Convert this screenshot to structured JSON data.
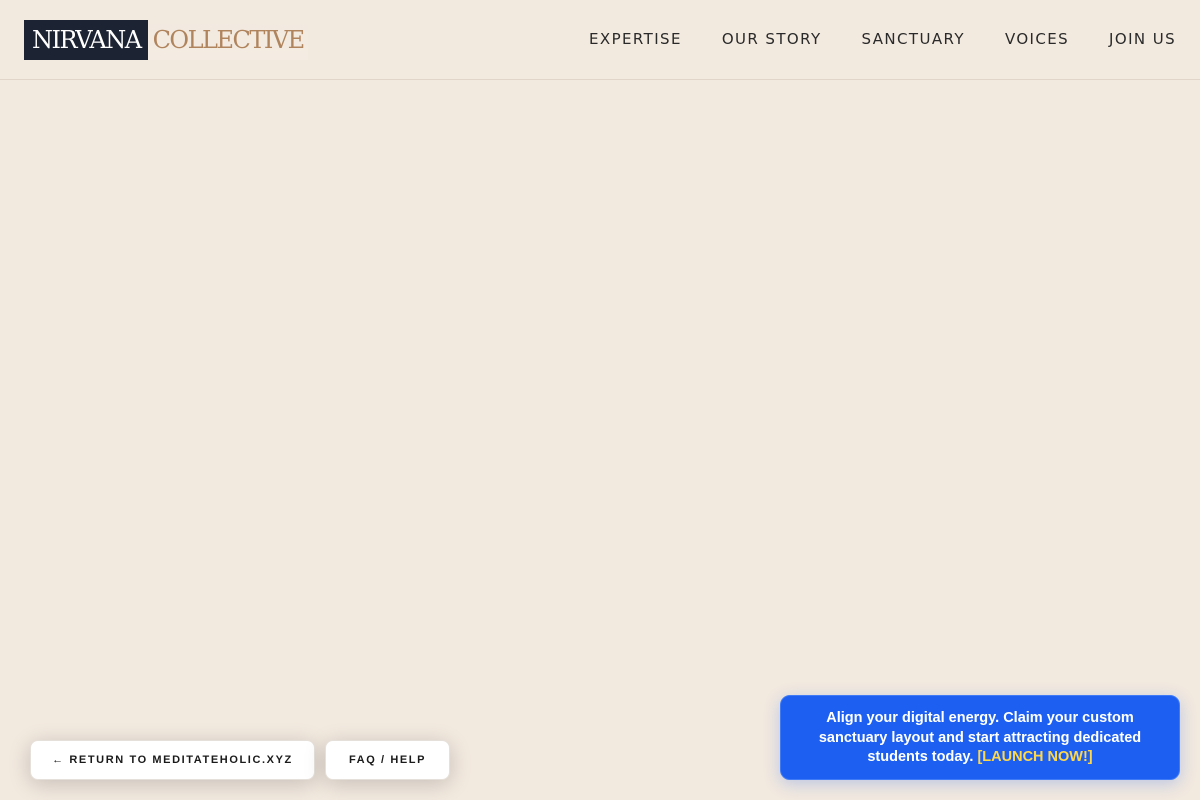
{
  "header": {
    "logo": {
      "part1": "NIRVANA",
      "part2": "COLLECTIVE"
    },
    "nav": [
      {
        "label": "EXPERTISE"
      },
      {
        "label": "OUR STORY"
      },
      {
        "label": "SANCTUARY"
      },
      {
        "label": "VOICES"
      },
      {
        "label": "JOIN US"
      }
    ]
  },
  "footer": {
    "return_label": "← RETURN TO MEDITATEHOLIC.XYZ",
    "faq_label": "FAQ / HELP"
  },
  "promo": {
    "text": "Align your digital energy. Claim your custom sanctuary layout and start attracting dedicated students today.",
    "cta": "[LAUNCH NOW!]"
  },
  "colors": {
    "background": "#f2e9df",
    "logo_dark": "#1c2333",
    "logo_accent": "#b0855e",
    "promo_blue": "#1d5ff0",
    "cta_yellow": "#ffd84a"
  }
}
